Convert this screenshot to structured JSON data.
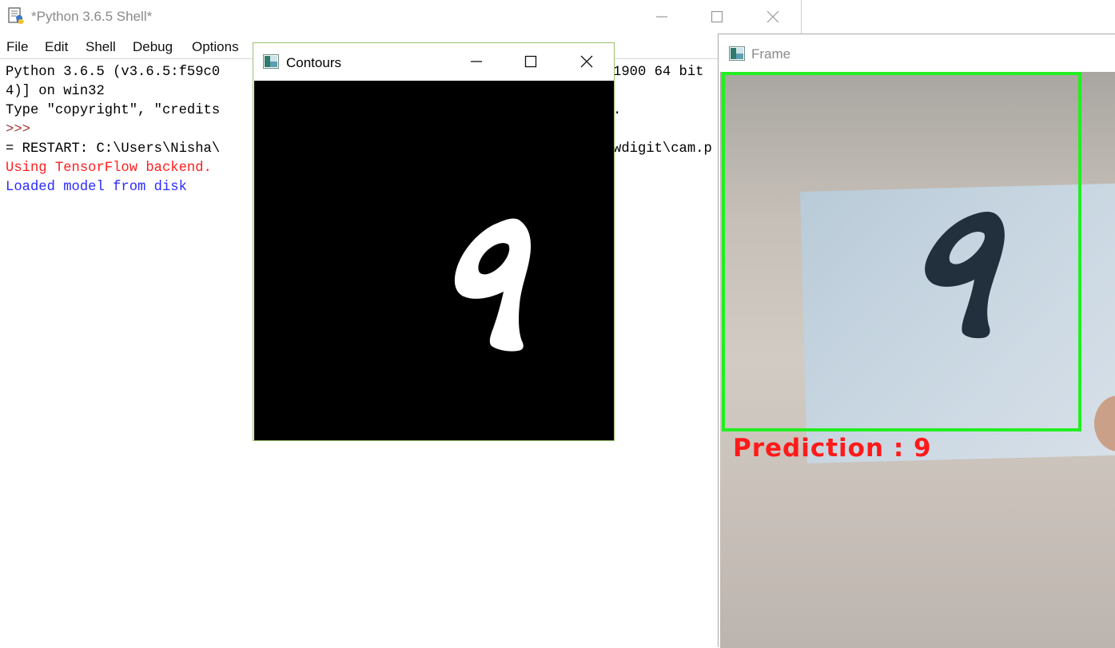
{
  "shell": {
    "title": "*Python 3.6.5 Shell*",
    "menu": [
      "File",
      "Edit",
      "Shell",
      "Debug",
      "Options"
    ],
    "lines": [
      {
        "text": "Python 3.6.5 (v3.6.5:f59c0",
        "color": "black"
      },
      {
        "text": "4)] on win32",
        "color": "black"
      },
      {
        "text": "Type \"copyright\", \"credits",
        "color": "black"
      },
      {
        "text": ">>>",
        "color": "prompt"
      },
      {
        "text": "= RESTART: C:\\Users\\Nisha\\",
        "color": "black"
      },
      {
        "text": "Using TensorFlow backend.",
        "color": "red"
      },
      {
        "text": "Loaded model from disk",
        "color": "blue"
      }
    ],
    "line0_tail": "1900 64 bit",
    "line4_tail": "wdigit\\cam.p",
    "line2_tail": "."
  },
  "contours": {
    "title": "Contours",
    "digit": "9"
  },
  "frame": {
    "title": "Frame",
    "prediction": "Prediction : 9",
    "colors": {
      "box": "#22ee22",
      "prediction": "#ff1a1a"
    }
  }
}
